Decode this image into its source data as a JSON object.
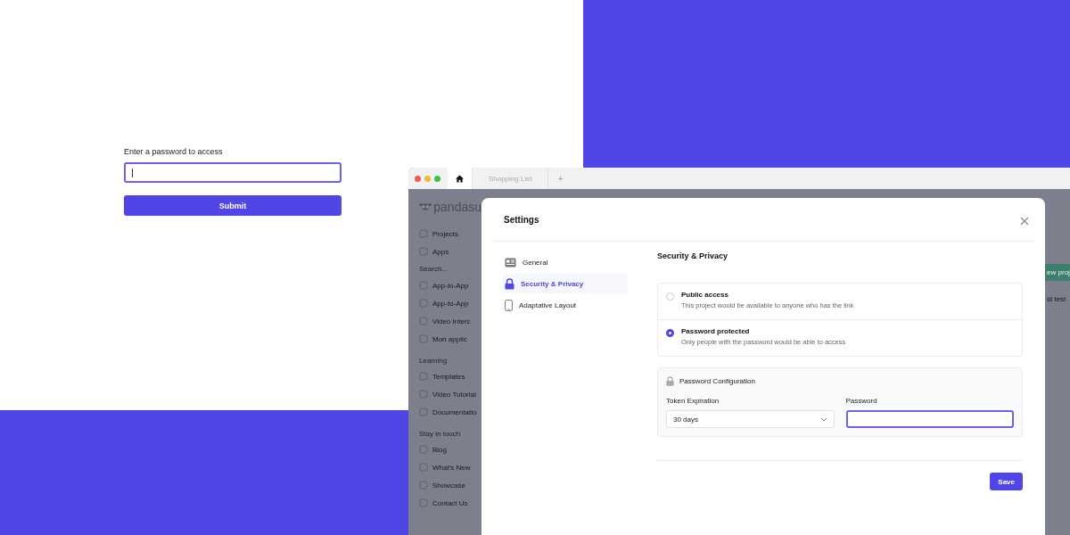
{
  "access_form": {
    "label": "Enter a password to access",
    "submit": "Submit"
  },
  "browser": {
    "tabs": [
      {
        "kind": "home",
        "selected": true
      },
      {
        "kind": "page",
        "label": "Shopping List",
        "selected": false
      }
    ],
    "new_tab": "+"
  },
  "sidebar": {
    "logo": "pandasu",
    "items": [
      {
        "kind": "item",
        "label": "Projects"
      },
      {
        "kind": "item",
        "label": "Apps"
      },
      {
        "kind": "search",
        "label": "Search..."
      },
      {
        "kind": "item",
        "label": "App-to-App"
      },
      {
        "kind": "item",
        "label": "App-to-App"
      },
      {
        "kind": "item",
        "label": "Video Interc"
      },
      {
        "kind": "item",
        "label": "Mon applic"
      },
      {
        "kind": "heading",
        "label": "Learning"
      },
      {
        "kind": "item",
        "label": "Templates"
      },
      {
        "kind": "item",
        "label": "Video Tutorial"
      },
      {
        "kind": "item",
        "label": "Documentatio"
      },
      {
        "kind": "heading",
        "label": "Stay in touch"
      },
      {
        "kind": "item",
        "label": "Blog"
      },
      {
        "kind": "item",
        "label": "What's New"
      },
      {
        "kind": "item",
        "label": "Showcase"
      },
      {
        "kind": "item",
        "label": "Contact Us"
      }
    ]
  },
  "backdrop_right": {
    "button": "ew proj",
    "text": "st test"
  },
  "modal": {
    "title": "Settings",
    "nav": [
      {
        "label": "General",
        "selected": false
      },
      {
        "label": "Security & Privacy",
        "selected": true
      },
      {
        "label": "Adaptative Layout",
        "selected": false
      }
    ],
    "section_title": "Security & Privacy",
    "access_options": [
      {
        "title": "Public access",
        "description": "This project would be available to anyone who has the link",
        "selected": false
      },
      {
        "title": "Password protected",
        "description": "Only people with the password would be able to access",
        "selected": true
      }
    ],
    "config": {
      "title": "Password Configuration",
      "token_label": "Token Expiration",
      "token_value": "30 days",
      "password_label": "Password"
    },
    "save": "Save"
  }
}
